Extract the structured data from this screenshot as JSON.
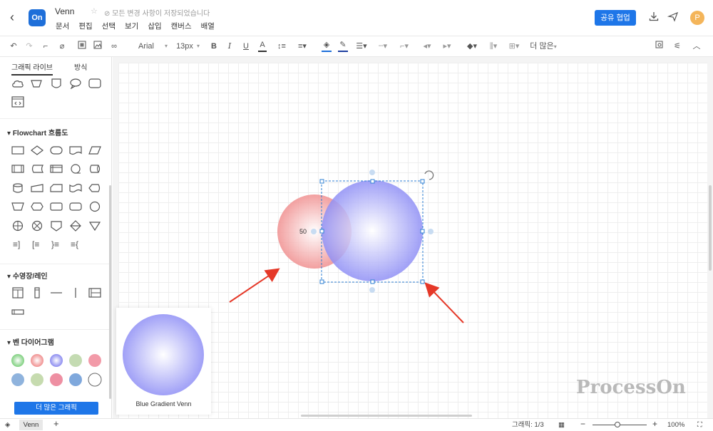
{
  "header": {
    "title": "Venn",
    "save_status": "모든 변경 사항이 저장되었습니다",
    "menu": [
      "문서",
      "편집",
      "선택",
      "보기",
      "삽입",
      "캔버스",
      "배열"
    ],
    "share_button": "공유 협업",
    "avatar_letter": "P",
    "logo_text": "On"
  },
  "toolbar": {
    "font_family": "Arial",
    "font_size": "13px",
    "more_label": "더 많은"
  },
  "left_panel": {
    "tabs": [
      "그래픽 라이브",
      "방식"
    ],
    "sections": {
      "flowchart": "Flowchart 흐름도",
      "swimlane": "수영장/레인",
      "venn": "벤 다이어그램"
    },
    "more_graphics_button": "더 많은 그래픽"
  },
  "canvas": {
    "small_circle_label": "50",
    "preview_label": "Blue Gradient Venn",
    "watermark": "ProcessOn",
    "colors": {
      "red_circle": "#f08f8f",
      "blue_circle": "#8f8ff5",
      "arrow": "#e53828",
      "selection": "#2d7fd3"
    }
  },
  "statusbar": {
    "page_tab": "Venn",
    "graphics_label": "그래픽:",
    "graphics_count": "1/3",
    "zoom": "100%"
  }
}
